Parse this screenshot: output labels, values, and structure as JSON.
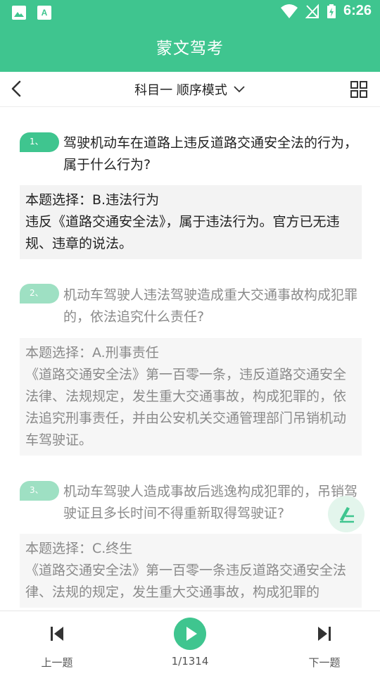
{
  "status_bar": {
    "time": "6:26"
  },
  "app": {
    "title": "蒙文驾考"
  },
  "toolbar": {
    "mode_label": "科目一 顺序模式"
  },
  "questions": [
    {
      "number": "1、",
      "text": "驾驶机动车在道路上违反道路交通安全法的行为，属于什么行为?",
      "answer_line": "本题选择：B.违法行为",
      "explanation": "违反《道路交通安全法》，属于违法行为。官方已无违规、违章的说法。"
    },
    {
      "number": "2、",
      "text": "机动车驾驶人违法驾驶造成重大交通事故构成犯罪的，依法追究什么责任?",
      "answer_line": "本题选择：A.刑事责任",
      "explanation": "《道路交通安全法》第一百零一条，违反道路交通安全法律、法规规定，发生重大交通事故，构成犯罪的，依法追究刑事责任，并由公安机关交通管理部门吊销机动车驾驶证。"
    },
    {
      "number": "3、",
      "text": "机动车驾驶人造成事故后逃逸构成犯罪的，吊销驾驶证且多长时间不得重新取得驾驶证?",
      "answer_line": "本题选择：C.终生",
      "explanation": "《道路交通安全法》第一百零一条违反道路交通安全法律、法规的规定，发生重大交通事故，构成犯罪的"
    }
  ],
  "bottom_bar": {
    "prev_label": "上一题",
    "counter": "1/1314",
    "next_label": "下一题"
  },
  "colors": {
    "accent": "#3fc58f",
    "badge_light": "#9ee0c3"
  }
}
